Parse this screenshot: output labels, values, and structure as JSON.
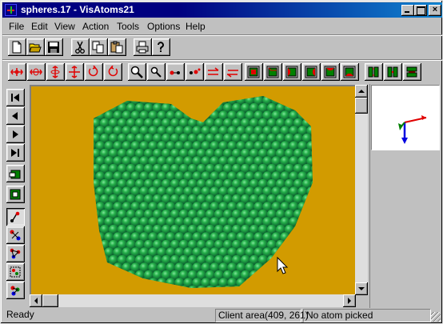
{
  "window": {
    "title": "spheres.17 - VisAtoms21",
    "close_glyph": "×"
  },
  "menu": [
    {
      "label": "File"
    },
    {
      "label": "Edit"
    },
    {
      "label": "View"
    },
    {
      "label": "Action"
    },
    {
      "label": "Tools"
    },
    {
      "label": "Options"
    },
    {
      "label": "Help"
    }
  ],
  "toolbar_top": {
    "buttons": [
      "new-file-icon",
      "open-folder-icon",
      "save-disk-icon",
      "cut-scissors-icon",
      "copy-icon",
      "paste-icon",
      "print-icon",
      "help-question-icon"
    ]
  },
  "toolbar_view": {
    "buttons": [
      "move-horizontal-icon",
      "move-vertical-icon",
      "rotate-x-icon",
      "rotate-y-icon",
      "rotate-ccw-icon",
      "rotate-cw-icon",
      "zoom-in-icon",
      "zoom-out-icon",
      "atom-pair-left-icon",
      "atom-pair-right-icon",
      "arrow-right-icon",
      "arrow-left-icon",
      "cube-front-icon",
      "cube-back-icon",
      "cube-left-icon",
      "cube-right-icon",
      "cube-top-icon",
      "cube-bottom-icon",
      "slab-x-icon",
      "slab-y-icon",
      "slab-z-icon"
    ],
    "accent": "#ff0000",
    "cube_color": "#008000"
  },
  "left_toolbar": {
    "buttons": [
      "first-frame-icon",
      "prev-frame-icon",
      "next-frame-icon",
      "last-frame-icon",
      "export-frame-icon",
      "import-frame-icon",
      "select-atom-icon",
      "select-pair-icon",
      "select-triple-icon",
      "select-region-icon",
      "color-atom-icon"
    ]
  },
  "viewport": {
    "background": "#d29b00",
    "atom_color": "#1e9b3c"
  },
  "axes_colors": {
    "x": "#ff0000",
    "y": "#008000",
    "z": "#0000ff"
  },
  "status": {
    "ready": "Ready",
    "client_area": "Client area(409, 261)",
    "atom": "No atom picked"
  }
}
